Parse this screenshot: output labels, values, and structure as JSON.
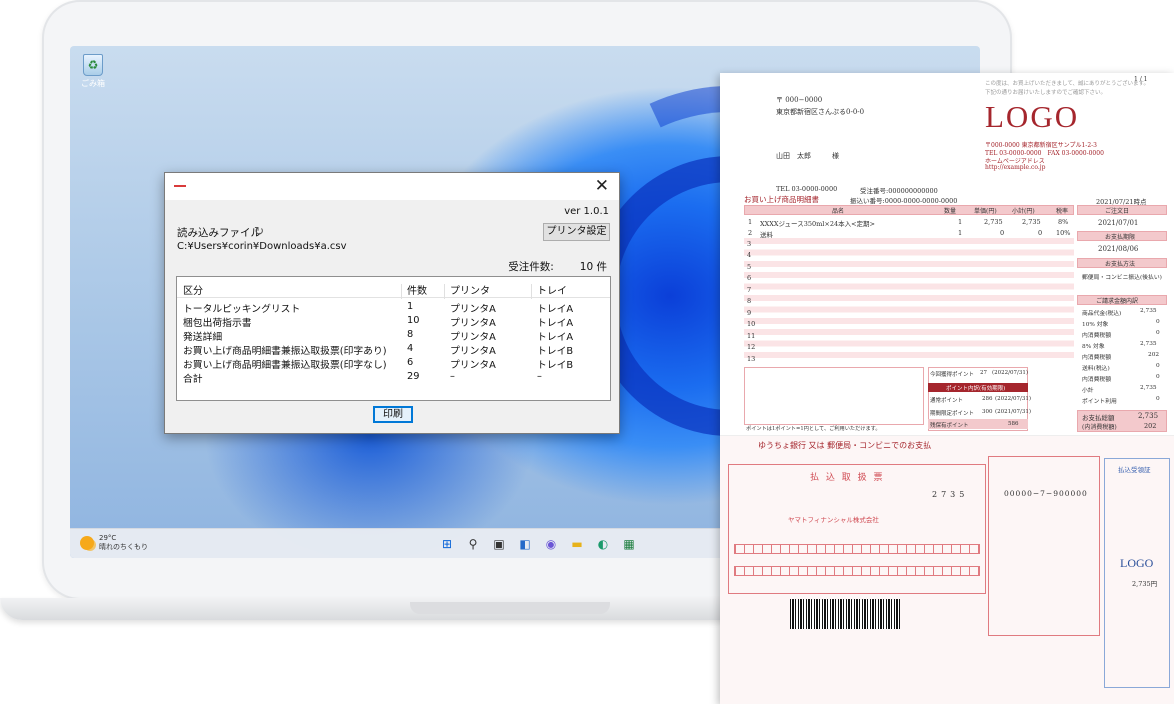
{
  "desktop": {
    "recycle_bin_label": "ごみ箱",
    "taskbar": {
      "weather_temp": "29°C",
      "weather_desc": "晴れのちくもり",
      "icons": [
        "windows-start-icon",
        "search-icon",
        "task-view-icon",
        "widgets-icon",
        "chat-icon",
        "file-explorer-icon",
        "edge-browser-icon",
        "store-icon"
      ]
    }
  },
  "app": {
    "version": "ver 1.0.1",
    "file_label": "読み込みファイル",
    "file_path": "C:¥Users¥corin¥Downloads¥a.csv",
    "printer_settings_button": "プリンタ設定",
    "order_count_label": "受注件数:",
    "order_count_value": "10",
    "order_count_unit": "件",
    "print_button": "印刷",
    "table": {
      "headers": [
        "区分",
        "件数",
        "プリンタ",
        "トレイ"
      ],
      "rows": [
        [
          "トータルピッキングリスト",
          "1",
          "プリンタA",
          "トレイA"
        ],
        [
          "梱包出荷指示書",
          "10",
          "プリンタA",
          "トレイA"
        ],
        [
          "発送詳細",
          "8",
          "プリンタA",
          "トレイA"
        ],
        [
          "お買い上げ商品明細書兼振込取扱票(印字あり)",
          "4",
          "プリンタA",
          "トレイB"
        ],
        [
          "お買い上げ商品明細書兼振込取扱票(印字なし)",
          "6",
          "プリンタA",
          "トレイB"
        ],
        [
          "合計",
          "29",
          "–",
          "–"
        ]
      ]
    }
  },
  "invoice": {
    "page_no": "1 / 1",
    "thanks": "この度は、お買上げいただきまして、誠にありがとうございます。",
    "thanks2": "下記の通りお届けいたしますのでご確認下さい。",
    "postal": "〒 000−0000",
    "address": "東京都新宿区さんぷる0-0-0",
    "customer": "山田　太郎　　　様",
    "tel": "TEL 03-0000-0000",
    "order_no": "受注番号:000000000000",
    "payment_no": "振込い番号:0000-0000-0000-0000",
    "logo": "LOGO",
    "company_addr": "〒000-0000 東京都新宿区サンプル1-2-3",
    "company_tel": "TEL 03-0000-0000　FAX 03-0000-0000",
    "company_hp": "ホームページアドレス",
    "company_url": "http://example.co.jp",
    "date": "2021/07/21時点",
    "title": "お買い上げ商品明細書",
    "cols": [
      "品名",
      "数量",
      "単価(円)",
      "小計(円)",
      "税率"
    ],
    "items": [
      {
        "no": "1",
        "name": "XXXXジュース350ml×24本入<定期>",
        "qty": "1",
        "price": "2,735",
        "sub": "2,735",
        "tax": "8%"
      },
      {
        "no": "2",
        "name": "送料",
        "qty": "1",
        "price": "0",
        "sub": "0",
        "tax": "10%"
      }
    ],
    "row_numbers": [
      "3",
      "4",
      "5",
      "6",
      "7",
      "8",
      "9",
      "10",
      "11",
      "12",
      "13"
    ],
    "side": {
      "order_date_label": "ご注文日",
      "order_date": "2021/07/01",
      "due_label": "お支払期限",
      "due": "2021/08/06",
      "method_label": "お支払方法",
      "method": "郵便局・コンビニ振込(後払い)",
      "detail_label": "ご請求金額内訳",
      "lines": [
        [
          "商品代金(税込)",
          "2,735"
        ],
        [
          "10% 対象",
          "0"
        ],
        [
          "内消費税額",
          "0"
        ],
        [
          "8% 対象",
          "2,735"
        ],
        [
          "内消費税額",
          "202"
        ],
        [
          "送料(税込)",
          "0"
        ],
        [
          "内消費税額",
          "0"
        ],
        [
          "小計",
          "2,735"
        ],
        [
          "ポイント利用",
          "0"
        ]
      ],
      "total_label": "お支払総額",
      "total": "2,735",
      "tax_note": "(内消費税額)",
      "tax_total": "202"
    },
    "points": {
      "this_time": "今回獲得ポイント",
      "this_val": "27",
      "this_date": "(2022/07/31)",
      "detail": "ポイント内訳(有効期限)",
      "normal": "通常ポイント",
      "normal_val": "286",
      "normal_date": "(2022/07/31)",
      "limited": "期間限定ポイント",
      "limited_val": "300",
      "limited_date": "(2021/07/31)",
      "balance": "残保有ポイント",
      "balance_val": "586",
      "note": "ポイントは1ポイント=1円として、ご利用いただけます。"
    },
    "slip": {
      "header": "ゆうちょ銀行 又は 郵便局・コンビニでのお支払",
      "title": "払 込 取 扱 票",
      "payee": "ヤマトフィナンシャル株式会社",
      "amount": "2735",
      "account": "00000−7−900000",
      "receipt": "払込受領証",
      "logo": "LOGO",
      "amount_yen": "2,735円"
    }
  }
}
